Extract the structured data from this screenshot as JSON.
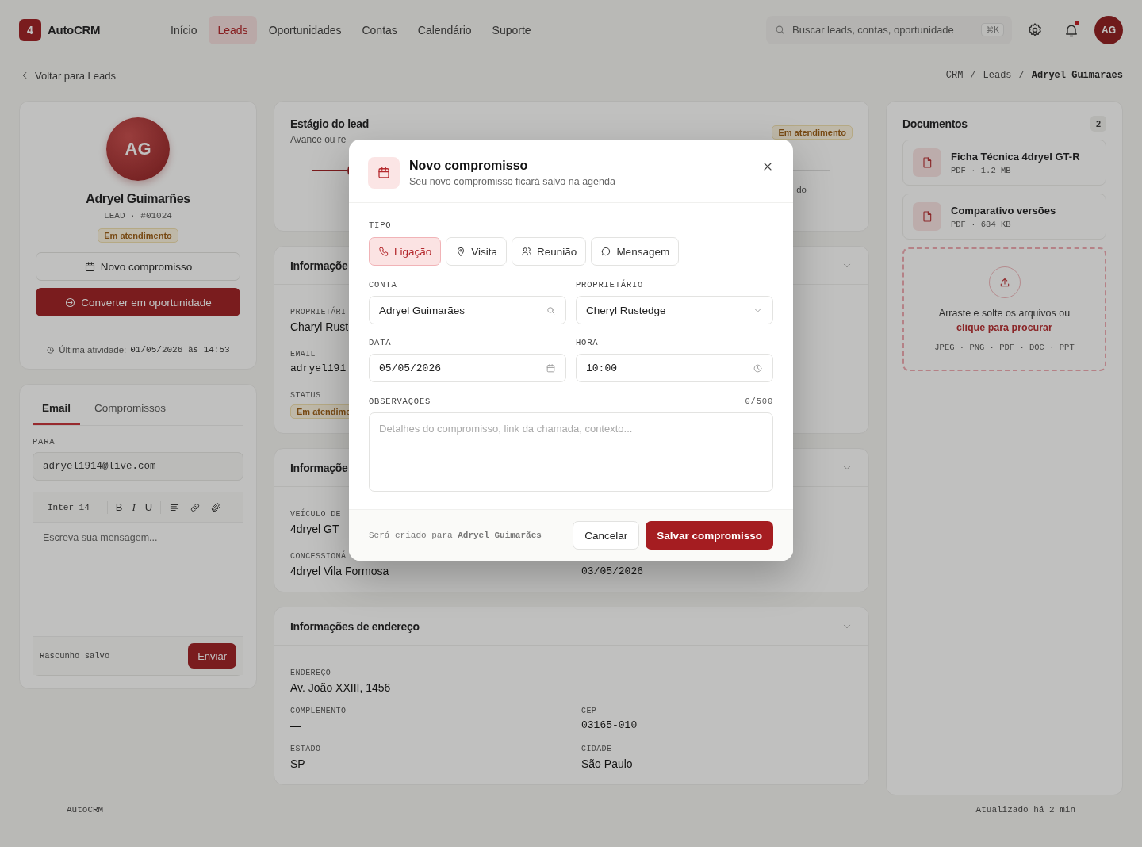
{
  "header": {
    "logo_mark": "4",
    "brand": "AutoCRM",
    "nav": [
      {
        "label": "Início",
        "selected": false
      },
      {
        "label": "Leads",
        "selected": true
      },
      {
        "label": "Oportunidades",
        "selected": false
      },
      {
        "label": "Contas",
        "selected": false
      },
      {
        "label": "Calendário",
        "selected": false
      },
      {
        "label": "Suporte",
        "selected": false
      }
    ],
    "search": {
      "placeholder": "Buscar leads, contas, oportunidade",
      "shortcut": "⌘K"
    },
    "notifications_unread": true,
    "avatar": "AG"
  },
  "back_link": "Voltar para Leads",
  "breadcrumb_separator": "/",
  "breadcrumb": [
    {
      "label": "CRM",
      "current": false
    },
    {
      "label": "Leads",
      "current": false
    },
    {
      "label": "Adryel Guimarães",
      "current": true
    }
  ],
  "profile": {
    "initials": "AG",
    "name": "Adryel Guimarñes",
    "meta": "LEAD · #01024",
    "status": "Em atendimento",
    "schedule_button": "Novo compromisso",
    "convert_button": "Converter em oportunidade",
    "activity_label": "Última atividade:",
    "activity_value": "01/05/2026 às 14:53"
  },
  "composer": {
    "tabs": [
      {
        "label": "Email",
        "selected": true
      },
      {
        "label": "Compromissos",
        "selected": false
      }
    ],
    "to_label": "PARA",
    "to_value": "adryel1914@live.com",
    "font": "Inter 14",
    "format_buttons": [
      "B",
      "I",
      "U"
    ],
    "placeholder": "Escreva sua mensagem...",
    "draft_status": "Rascunho salvo",
    "send_button": "Enviar"
  },
  "stage": {
    "title": "Estágio do lead",
    "subtitle": "Avance ou re",
    "badge": "Em atendimento",
    "step_label": "do"
  },
  "info_card": {
    "title": "Informaçõe",
    "fields": [
      {
        "label": "PROPRIETÁRI",
        "value": "Charyl Rust",
        "kind": "text"
      },
      {
        "label": "EMAIL",
        "value": "adryel191",
        "kind": "mono"
      },
      {
        "label": "STATUS",
        "value": "Em atendime",
        "kind": "badge"
      }
    ]
  },
  "vehicle_card": {
    "title": "Informaçõe",
    "fields": [
      {
        "label": "VEÍCULO DE",
        "value": "4dryel GT"
      },
      {
        "label": "CONCESSIONÁ",
        "value": "4dryel Vila Formosa"
      }
    ],
    "side_value": "03/05/2026"
  },
  "address_card": {
    "title": "Informações de endereço",
    "fields": [
      {
        "label": "ENDEREÇO",
        "value": "Av. João XXIII, 1456",
        "kind": "text",
        "wide": true
      },
      {
        "label": "COMPLEMENTO",
        "value": "—",
        "kind": "text",
        "wide": false
      },
      {
        "label": "CEP",
        "value": "03165-010",
        "kind": "mono",
        "wide": false
      },
      {
        "label": "ESTADO",
        "value": "SP",
        "kind": "text",
        "wide": false
      },
      {
        "label": "CIDADE",
        "value": "São Paulo",
        "kind": "text",
        "wide": false
      }
    ]
  },
  "documents": {
    "title": "Documentos",
    "count": "2",
    "meta_separator": "·",
    "files": [
      {
        "name": "Ficha Técnica 4dryel GT-R",
        "type": "PDF",
        "size": "1.2 MB"
      },
      {
        "name": "Comparativo versões",
        "type": "PDF",
        "size": "684 KB"
      }
    ],
    "drop_text": "Arraste e solte os arquivos ou",
    "drop_link": "clique para procurar",
    "formats": "JPEG · PNG · PDF · DOC · PPT"
  },
  "footer": {
    "brand": "AutoCRM",
    "updated": "Atualizado há 2 min"
  },
  "modal": {
    "title": "Novo compromisso",
    "subtitle": "Seu novo compromisso ficará salvo na agenda",
    "type_label": "TIPO",
    "types": [
      {
        "label": "Ligação",
        "kind": "call",
        "selected": true
      },
      {
        "label": "Visita",
        "kind": "visit",
        "selected": false
      },
      {
        "label": "Reunião",
        "kind": "meeting",
        "selected": false
      },
      {
        "label": "Mensagem",
        "kind": "message",
        "selected": false
      }
    ],
    "fields": [
      {
        "label": "CONTA",
        "value": "Adryel Guimarães",
        "kind": "search"
      },
      {
        "label": "PROPRIETÁRIO",
        "value": "Cheryl Rustedge",
        "kind": "select"
      },
      {
        "label": "DATA",
        "value": "05/05/2026",
        "kind": "date"
      },
      {
        "label": "HORA",
        "value": "10:00",
        "kind": "time"
      }
    ],
    "notes_label": "OBSERVAÇÕES",
    "notes_counter": "0/500",
    "notes_placeholder": "Detalhes do compromisso, link da chamada, contexto...",
    "footer_note": "Será criado para **Adryel Guimarães**",
    "cancel_button": "Cancelar",
    "save_button": "Salvar compromisso"
  }
}
